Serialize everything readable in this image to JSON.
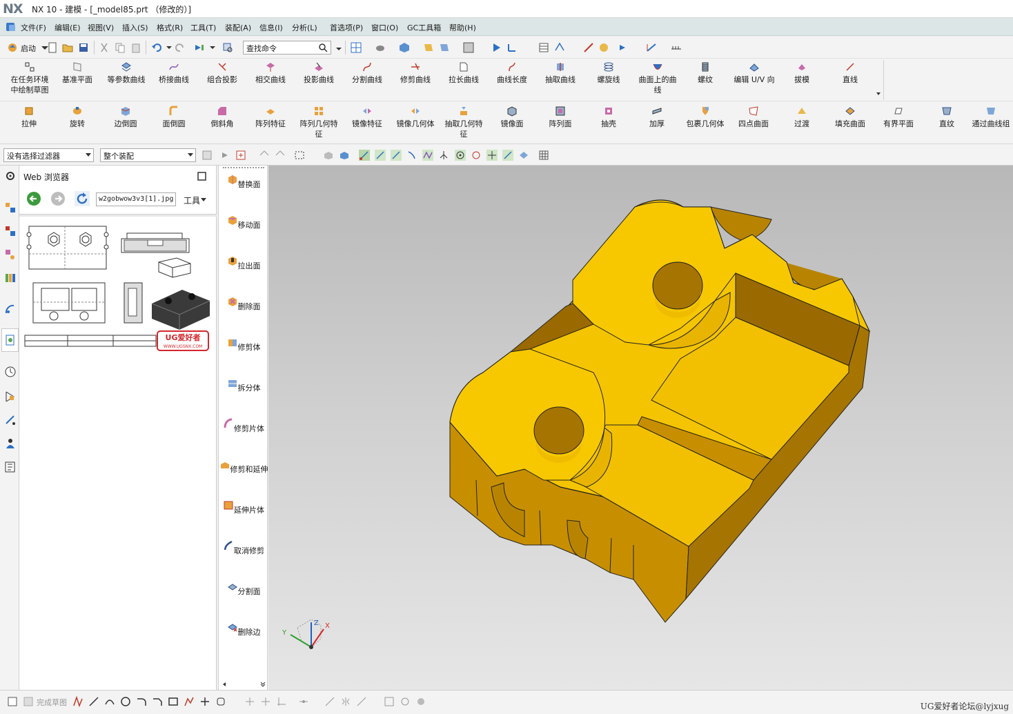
{
  "app": {
    "logo": "NX",
    "title": "NX 10 - 建模 - [_model85.prt （修改的）]"
  },
  "menu": [
    "文件(F)",
    "编辑(E)",
    "视图(V)",
    "插入(S)",
    "格式(R)",
    "工具(T)",
    "装配(A)",
    "信息(I)",
    "分析(L)",
    "首选项(P)",
    "窗口(O)",
    "GC工具箱",
    "帮助(H)"
  ],
  "quickbar": {
    "start_label": "启动",
    "search_placeholder": "查找命令"
  },
  "curve_tools": [
    "在任务环境中绘制草图",
    "基准平面",
    "等参数曲线",
    "桥接曲线",
    "组合投影",
    "相交曲线",
    "投影曲线",
    "分割曲线",
    "修剪曲线",
    "拉长曲线",
    "曲线长度",
    "抽取曲线",
    "螺旋线",
    "曲面上的曲线",
    "螺纹",
    "编辑 U/V 向",
    "拔模",
    "直线"
  ],
  "feature_tools": [
    "拉伸",
    "旋转",
    "边倒圆",
    "面倒圆",
    "倒斜角",
    "阵列特征",
    "阵列几何特征",
    "镜像特征",
    "镜像几何体",
    "抽取几何特征",
    "镜像面",
    "阵列面",
    "抽壳",
    "加厚",
    "包裹几何体",
    "四点曲面",
    "过渡",
    "填充曲面",
    "有界平面",
    "直纹",
    "通过曲线组"
  ],
  "selection": {
    "filter": "没有选择过滤器",
    "scope": "整个装配"
  },
  "web_browser": {
    "title": "Web 浏览器",
    "address": "w2gobwow3v3[1].jpg",
    "tools_label": "工具",
    "stamp_text": "UG爱好者",
    "stamp_url": "WWW.UGSNX.COM"
  },
  "side_commands": [
    "替换面",
    "移动面",
    "拉出面",
    "删除面",
    "修剪体",
    "拆分体",
    "修剪片体",
    "修剪和延伸",
    "延伸片体",
    "取消修剪",
    "分割面",
    "删除边"
  ],
  "triad": {
    "x": "X",
    "y": "Y",
    "z": "Z"
  },
  "status": {
    "finish_sketch": "完成草图",
    "watermark": "UG爱好者论坛@lyjxug"
  },
  "colors": {
    "part_face": "#f5c400",
    "part_side": "#c78f00",
    "part_dark": "#9a6a00",
    "menubar": "#dde6e6"
  }
}
